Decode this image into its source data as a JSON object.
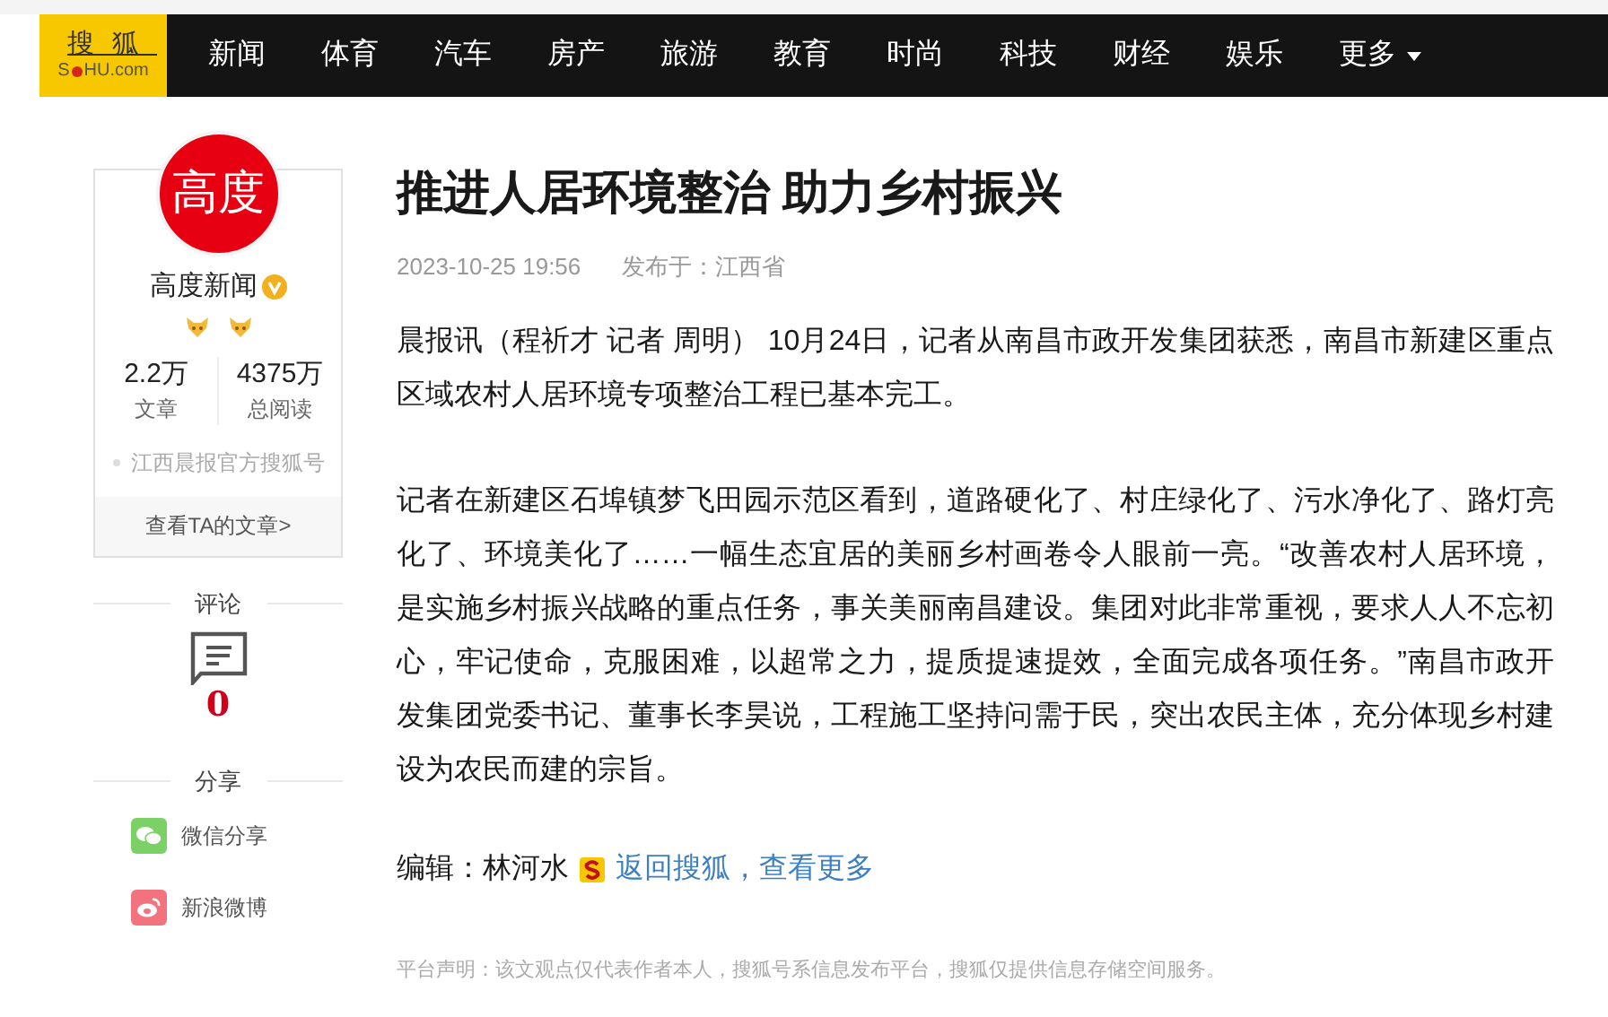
{
  "header": {
    "logo_top": "搜狐",
    "logo_bottom": [
      "S",
      "HU.com"
    ],
    "nav": [
      {
        "label": "新闻"
      },
      {
        "label": "体育"
      },
      {
        "label": "汽车"
      },
      {
        "label": "房产"
      },
      {
        "label": "旅游"
      },
      {
        "label": "教育"
      },
      {
        "label": "时尚"
      },
      {
        "label": "科技"
      },
      {
        "label": "财经"
      },
      {
        "label": "娱乐"
      },
      {
        "label": "更多",
        "kind": "dropdown"
      }
    ]
  },
  "author": {
    "avatar_text": "高度",
    "name": "高度新闻",
    "verified": true,
    "stats": [
      {
        "value": "2.2万",
        "label": "文章"
      },
      {
        "value": "4375万",
        "label": "总阅读"
      }
    ],
    "description": "江西晨报官方搜狐号",
    "link": "查看TA的文章>"
  },
  "comments": {
    "label": "评论",
    "count": "0"
  },
  "share": {
    "label": "分享",
    "items": [
      {
        "kind": "wechat",
        "label": "微信分享",
        "color": "#7bd166"
      },
      {
        "kind": "weibo",
        "label": "新浪微博",
        "color": "#f2737d"
      }
    ]
  },
  "article": {
    "title": "推进人居环境整治 助力乡村振兴",
    "date": "2023-10-25 19:56",
    "location": "发布于：江西省",
    "paragraphs": [
      "晨报讯（程祈才 记者 周明） 10月24日，记者从南昌市政开发集团获悉，南昌市新建区重点区域农村人居环境专项整治工程已基本完工。",
      "记者在新建区石埠镇梦飞田园示范区看到，道路硬化了、村庄绿化了、污水净化了、路灯亮化了、环境美化了……一幅生态宜居的美丽乡村画卷令人眼前一亮。“改善农村人居环境，是实施乡村振兴战略的重点任务，事关美丽南昌建设。集团对此非常重视，要求人人不忘初心，牢记使命，克服困难，以超常之力，提质提速提效，全面完成各项任务。”南昌市政开发集团党委书记、董事长李昊说，工程施工坚持问需于民，突出农民主体，充分体现乡村建设为农民而建的宗旨。"
    ],
    "editor": "编辑：林河水",
    "back_link": "返回搜狐，查看更多",
    "disclaimer": "平台声明：该文观点仅代表作者本人，搜狐号系信息发布平台，搜狐仅提供信息存储空间服务。"
  }
}
